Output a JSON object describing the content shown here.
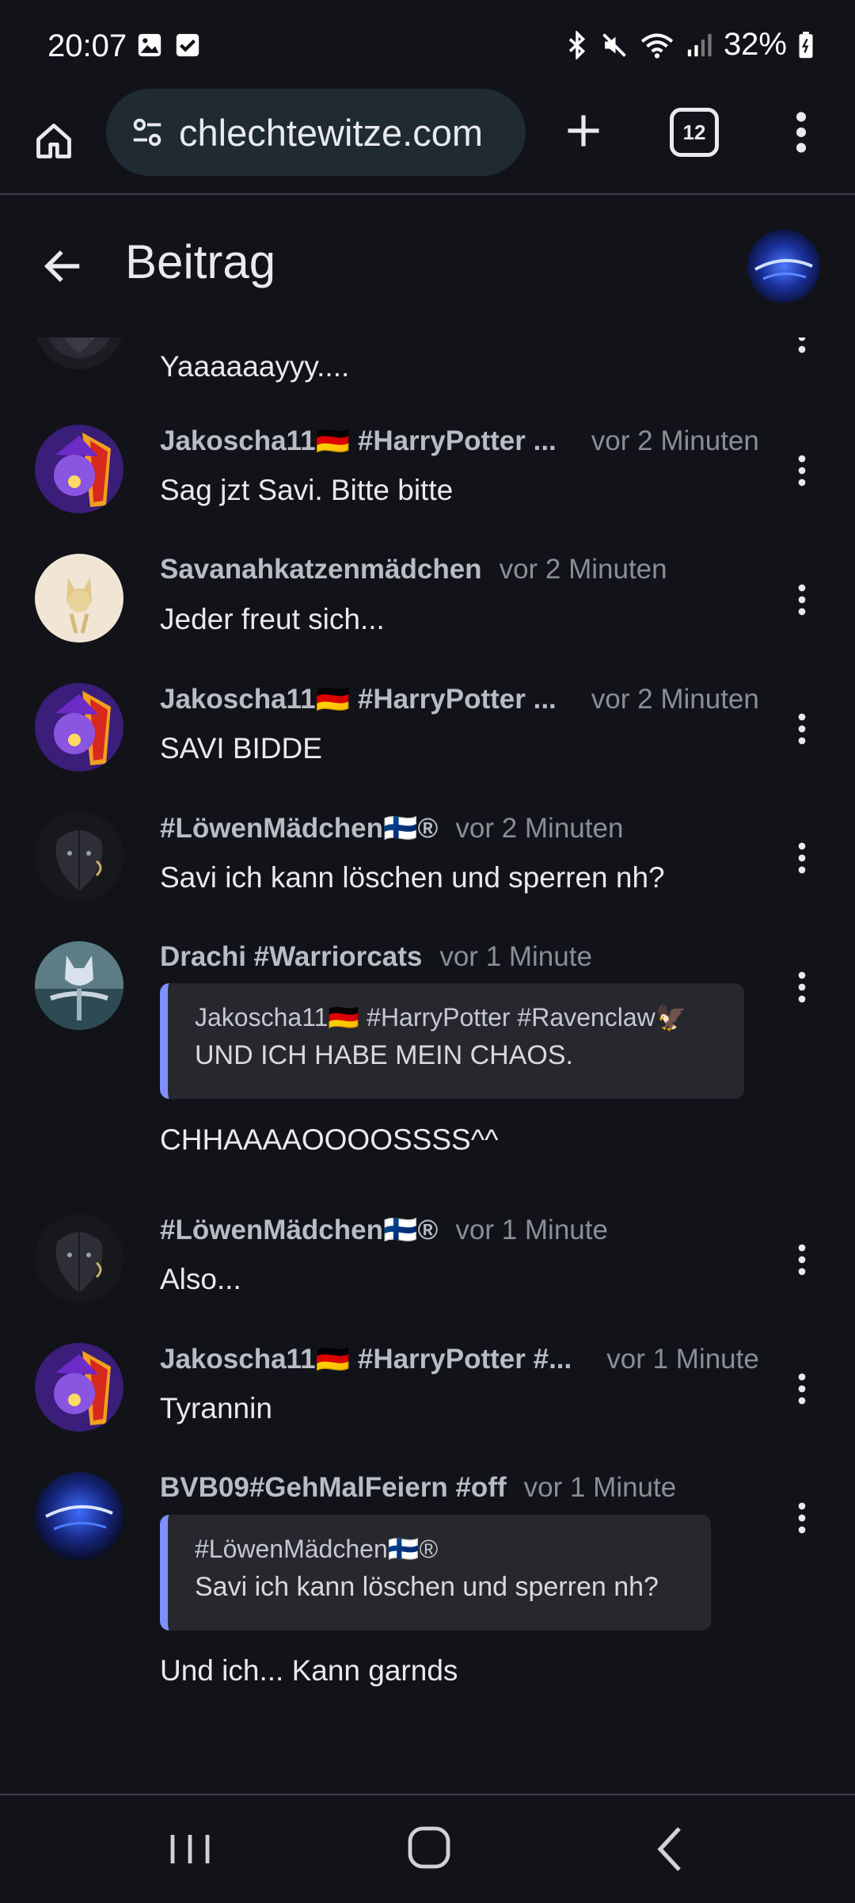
{
  "status_bar": {
    "time": "20:07",
    "battery": "32%"
  },
  "browser": {
    "url": "chlechtewitze.com",
    "tab_count": "12"
  },
  "page": {
    "title": "Beitrag"
  },
  "posts": [
    {
      "author": "",
      "time": "",
      "text": "Yaaaaaayyy...."
    },
    {
      "author": "Jakoscha11🇩🇪 #HarryPotter ...",
      "time": "vor 2 Minuten",
      "text": "Sag jzt Savi. Bitte bitte"
    },
    {
      "author": "Savanahkatzenmädchen",
      "time": "vor 2 Minuten",
      "text": "Jeder freut sich..."
    },
    {
      "author": "Jakoscha11🇩🇪 #HarryPotter ...",
      "time": "vor 2 Minuten",
      "text": "SAVI BIDDE"
    },
    {
      "author": "#LöwenMädchen🇫🇮®",
      "time": "vor 2 Minuten",
      "text": "Savi ich kann löschen und sperren nh?"
    },
    {
      "author": "Drachi #Warriorcats",
      "time": "vor 1 Minute",
      "quote_author": "Jakoscha11🇩🇪 #HarryPotter #Ravenclaw🦅",
      "quote_text": "UND ICH HABE MEIN CHAOS.",
      "text": "CHHAAAAOOOOSSSS^^"
    },
    {
      "author": "#LöwenMädchen🇫🇮®",
      "time": "vor 1 Minute",
      "text": "Also..."
    },
    {
      "author": "Jakoscha11🇩🇪 #HarryPotter #...",
      "time": "vor 1 Minute",
      "text": "Tyrannin"
    },
    {
      "author": "BVB09#GehMalFeiern #off",
      "time": "vor 1 Minute",
      "quote_author": "#LöwenMädchen🇫🇮®",
      "quote_text": "Savi ich kann löschen und sperren nh?",
      "text": "Und ich... Kann garnds"
    }
  ]
}
